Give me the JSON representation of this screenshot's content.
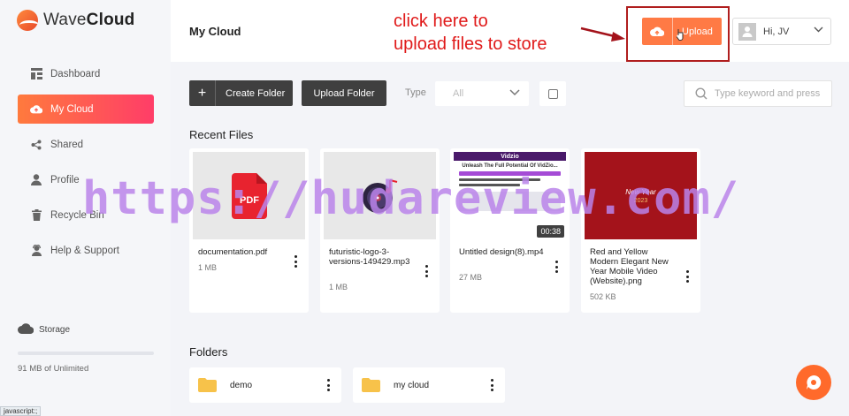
{
  "app": {
    "name_prefix": "Wave",
    "name_bold": "Cloud"
  },
  "sidebar": {
    "items": [
      {
        "label": "Dashboard",
        "icon": "dashboard-icon"
      },
      {
        "label": "My Cloud",
        "icon": "cloud-upload-icon",
        "active": true
      },
      {
        "label": "Shared",
        "icon": "share-icon"
      },
      {
        "label": "Profile",
        "icon": "user-icon"
      },
      {
        "label": "Recycle Bin",
        "icon": "trash-icon"
      },
      {
        "label": "Help & Support",
        "icon": "support-icon"
      }
    ],
    "storage_label": "Storage",
    "storage_usage": "91 MB of Unlimited"
  },
  "header": {
    "title": "My Cloud",
    "annotation_line1": "click here to",
    "annotation_line2": "upload files to store",
    "upload_label": "Upload",
    "user_greeting": "Hi, JV"
  },
  "toolbar": {
    "create_folder": "Create Folder",
    "upload_folder": "Upload Folder",
    "type_label": "Type",
    "type_value": "All",
    "search_placeholder": "Type keyword and press"
  },
  "recent_files": {
    "title": "Recent Files",
    "items": [
      {
        "name": "documentation.pdf",
        "size": "1 MB",
        "kind": "pdf"
      },
      {
        "name": "futuristic-logo-3-versions-149429.mp3",
        "size": "1 MB",
        "kind": "audio"
      },
      {
        "name": "Untitled design(8).mp4",
        "size": "27 MB",
        "kind": "video",
        "duration": "00:38",
        "thumb_title": "Vidzio",
        "thumb_headline": "Unleash The Full Potential Of VidZio..."
      },
      {
        "name": "Red and Yellow Modern Elegant New Year Mobile Video (Website).png",
        "size": "502 KB",
        "kind": "image",
        "thumb_text": "New Year",
        "thumb_year": "2023"
      }
    ]
  },
  "folders": {
    "title": "Folders",
    "items": [
      {
        "name": "demo"
      },
      {
        "name": "my cloud"
      }
    ]
  },
  "status_tip": "javascript:;",
  "watermark": "https://hudareview.com/",
  "colors": {
    "accent_start": "#ff7a3d",
    "accent_end": "#ff3d68",
    "upload": "#ff7a45",
    "annotation": "#e01a1a",
    "chat": "#ff6a2b"
  }
}
